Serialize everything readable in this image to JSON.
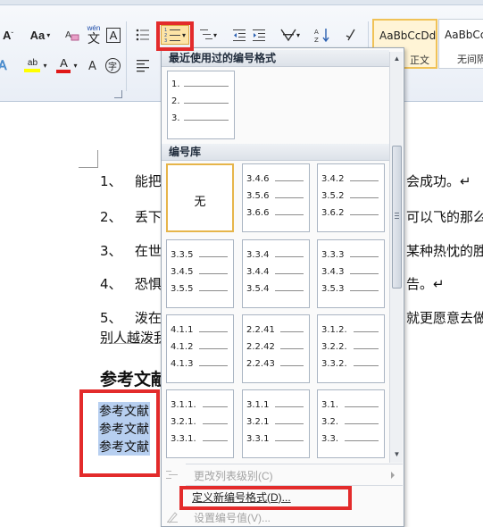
{
  "ribbon": {
    "font_size_button": "Aa",
    "change_case_button": "Aa",
    "wen_label": "wén",
    "wen_char": "文",
    "border_char": "A",
    "circle_char": "字",
    "font_color_char": "A",
    "highlight_char": "ab",
    "dropdown_char": "A",
    "styles": [
      {
        "sample": "AaBbCcDd",
        "name": "正文"
      },
      {
        "sample": "AaBbCcI",
        "name": "无间隔"
      }
    ]
  },
  "document": {
    "paragraphs": [
      {
        "number": "1、",
        "text_left": "能把在",
        "text_right": "会成功。↵"
      },
      {
        "number": "2、",
        "text_left": "丢下一",
        "text_right": "可以飞的那么高"
      },
      {
        "number": "3、",
        "text_left": "在世界",
        "text_right": "某种热忱的胜利"
      },
      {
        "number": "4、",
        "text_left": "恐惧自",
        "text_right": "告。↵"
      },
      {
        "number": "5、",
        "text_left": "泼在你",
        "text_right": "就更愿意去做什"
      }
    ],
    "para5_line2": "别人越泼我",
    "heading": "参考文献",
    "references": [
      "参考文献",
      "参考文献",
      "参考文献"
    ]
  },
  "dropdown": {
    "recent_header": "最近使用过的编号格式",
    "recent_format": [
      "1.",
      "2.",
      "3."
    ],
    "library_header": "编号库",
    "library": [
      {
        "none": "无"
      },
      {
        "rows": [
          "3.4.6",
          "3.5.6",
          "3.6.6"
        ]
      },
      {
        "rows": [
          "3.4.2",
          "3.5.2",
          "3.6.2"
        ]
      },
      {
        "rows": [
          "3.3.5",
          "3.4.5",
          "3.5.5"
        ]
      },
      {
        "rows": [
          "3.3.4",
          "3.4.4",
          "3.5.4"
        ]
      },
      {
        "rows": [
          "3.3.3",
          "3.4.3",
          "3.5.3"
        ]
      },
      {
        "rows": [
          "4.1.1",
          "4.1.2",
          "4.1.3"
        ]
      },
      {
        "rows": [
          "2.2.41",
          "2.2.42",
          "2.2.43"
        ]
      },
      {
        "rows": [
          "3.1.2.",
          "3.2.2.",
          "3.3.2."
        ]
      },
      {
        "rows": [
          "3.1.1.",
          "3.2.1.",
          "3.3.1."
        ]
      },
      {
        "rows": [
          "3.1.1",
          "3.2.1",
          "3.3.1"
        ]
      },
      {
        "rows": [
          "3.1.",
          "3.2.",
          "3.3."
        ]
      }
    ],
    "menu": [
      {
        "label": "更改列表级别(C)",
        "disabled": true
      },
      {
        "label": "定义新编号格式(D)...",
        "disabled": false
      },
      {
        "label": "设置编号值(V)...",
        "disabled": true
      }
    ]
  },
  "colors": {
    "highlight_red": "#e32b2b",
    "selection_blue": "#b7cff0",
    "hover_gold": "#e6b54a",
    "style_selected": "#f0c257"
  }
}
